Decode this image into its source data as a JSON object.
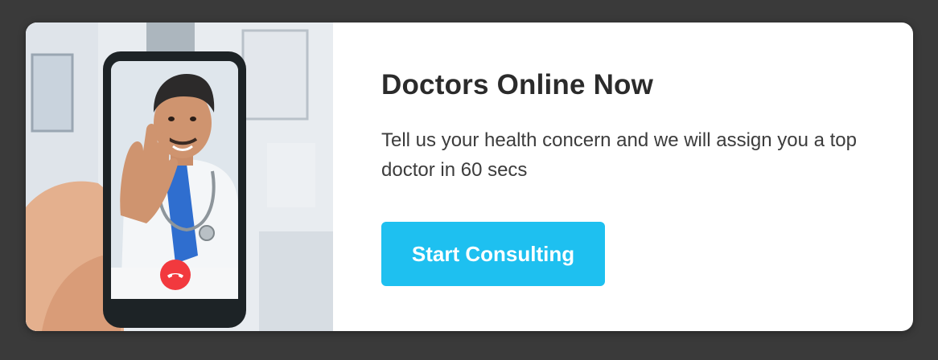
{
  "banner": {
    "title": "Doctors Online Now",
    "description": "Tell us your health concern and we will assign you a top doctor in 60 secs",
    "cta_label": "Start Consulting",
    "cta_color": "#1ec0f0",
    "end_call_color": "#f2393e",
    "photo_icon": "video-call-doctor-illustration",
    "end_call_icon": "phone-hangup-icon"
  }
}
